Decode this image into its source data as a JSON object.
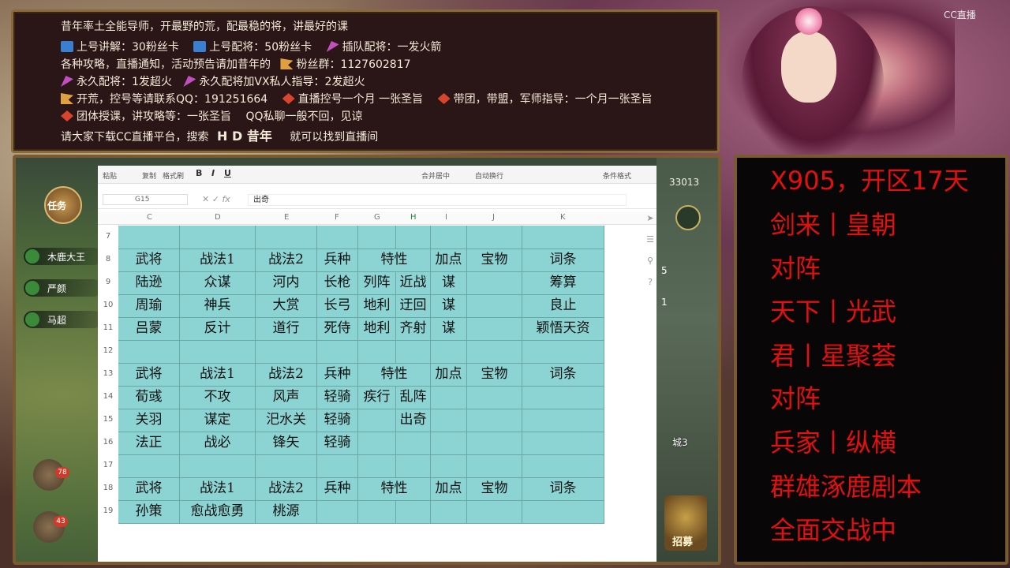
{
  "banner": {
    "line1": "昔年率土全能导师，开最野的荒，配最稳的将，讲最好的课",
    "line2a": "上号讲解：30粉丝卡",
    "line2b": "上号配将：50粉丝卡",
    "line2c": "插队配将：一发火箭",
    "line3a": "各种攻略，直播通知，活动预告请加昔年的",
    "line3b": "粉丝群：1127602817",
    "line4a": "永久配将：1发超火",
    "line4b": "永久配将加VX私人指导：2发超火",
    "line5a": "开荒，控号等请联系QQ：191251664",
    "line5b": "直播控号一个月 一张圣旨",
    "line5c": "带团，带盟，军师指导：一个月一张圣旨",
    "line6a": "团体授课，讲攻略等：一张圣旨",
    "line6b": "QQ私聊一般不回，见谅",
    "line7a": "请大家下载CC直播平台，搜索",
    "line7b": "H D  昔年",
    "line7c": "就可以找到直播间"
  },
  "cc_logo": "CC直播",
  "game": {
    "resource_count": "33013",
    "task_label": "任务",
    "heroes": [
      "木鹿大王",
      "严颜",
      "马超"
    ],
    "city_label": "城3",
    "recruit_label": "招募",
    "mail_badge": "78",
    "chat_badge": "43",
    "side_numbers": [
      "5",
      "1"
    ]
  },
  "sheet": {
    "toolbar": {
      "paste": "粘贴",
      "copy": "复制",
      "format": "格式刷",
      "bold": "B",
      "italic": "I",
      "underline": "U",
      "merge": "合并居中",
      "wrap": "自动换行",
      "cond": "条件格式"
    },
    "cell_ref": "G15",
    "formula": "出奇",
    "columns": [
      "C",
      "D",
      "E",
      "F",
      "G",
      "H",
      "I",
      "J",
      "K"
    ],
    "rows": [
      {
        "num": "7",
        "cells": [
          "",
          "",
          "",
          "",
          "",
          "",
          "",
          "",
          ""
        ]
      },
      {
        "num": "8",
        "cells": [
          "武将",
          "战法1",
          "战法2",
          "兵种",
          "特性",
          "",
          "加点",
          "宝物",
          "词条"
        ]
      },
      {
        "num": "9",
        "cells": [
          "陆逊",
          "众谋",
          "河内",
          "长枪",
          "列阵",
          "近战",
          "谋",
          "",
          "筹算"
        ]
      },
      {
        "num": "10",
        "cells": [
          "周瑜",
          "神兵",
          "大赏",
          "长弓",
          "地利",
          "迂回",
          "谋",
          "",
          "良止"
        ]
      },
      {
        "num": "11",
        "cells": [
          "吕蒙",
          "反计",
          "道行",
          "死侍",
          "地利",
          "齐射",
          "谋",
          "",
          "颖悟天资"
        ]
      },
      {
        "num": "12",
        "cells": [
          "",
          "",
          "",
          "",
          "",
          "",
          "",
          "",
          ""
        ]
      },
      {
        "num": "13",
        "cells": [
          "武将",
          "战法1",
          "战法2",
          "兵种",
          "特性",
          "",
          "加点",
          "宝物",
          "词条"
        ]
      },
      {
        "num": "14",
        "cells": [
          "荀彧",
          "不攻",
          "风声",
          "轻骑",
          "疾行",
          "乱阵",
          "",
          "",
          ""
        ]
      },
      {
        "num": "15",
        "cells": [
          "关羽",
          "谋定",
          "汜水关",
          "轻骑",
          "",
          "出奇",
          "",
          "",
          ""
        ]
      },
      {
        "num": "16",
        "cells": [
          "法正",
          "战必",
          "锋矢",
          "轻骑",
          "",
          "",
          "",
          "",
          ""
        ]
      },
      {
        "num": "17",
        "cells": [
          "",
          "",
          "",
          "",
          "",
          "",
          "",
          "",
          ""
        ]
      },
      {
        "num": "18",
        "cells": [
          "武将",
          "战法1",
          "战法2",
          "兵种",
          "特性",
          "",
          "加点",
          "宝物",
          "词条"
        ]
      },
      {
        "num": "19",
        "cells": [
          "孙策",
          "愈战愈勇",
          "桃源",
          "",
          "",
          "",
          "",
          "",
          ""
        ]
      }
    ]
  },
  "right_panel": {
    "lines": [
      "X905，开区17天",
      "剑来丨皇朝",
      "对阵",
      "天下丨光武",
      "君丨星聚荟",
      "对阵",
      "兵家丨纵横",
      "群雄涿鹿剧本",
      "全面交战中"
    ]
  }
}
